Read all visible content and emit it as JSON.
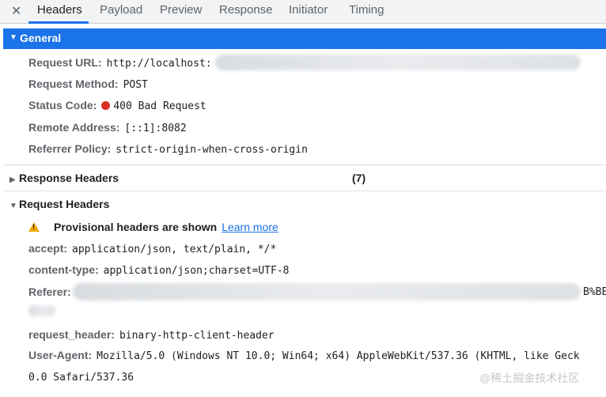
{
  "tabs": {
    "close": "✕",
    "items": [
      "Headers",
      "Payload",
      "Preview",
      "Response",
      "Initiator",
      "Timing"
    ],
    "active": "Headers"
  },
  "general": {
    "title": "General",
    "rows": {
      "request_url": {
        "key": "Request URL:",
        "value": "http://localhost:"
      },
      "request_method": {
        "key": "Request Method:",
        "value": "POST"
      },
      "status_code": {
        "key": "Status Code:",
        "value": "400 Bad Request",
        "status_color": "#d93025"
      },
      "remote_address": {
        "key": "Remote Address:",
        "value": "[::1]:8082"
      },
      "referrer_policy": {
        "key": "Referrer Policy:",
        "value": "strict-origin-when-cross-origin"
      }
    }
  },
  "response_headers": {
    "title": "Response Headers",
    "count": "(7)"
  },
  "request_headers": {
    "title": "Request Headers",
    "warning": "Provisional headers are shown",
    "learn_more": "Learn more",
    "rows": {
      "accept": {
        "key": "accept:",
        "value": "application/json, text/plain, */*"
      },
      "content_type": {
        "key": "content-type:",
        "value": "application/json;charset=UTF-8"
      },
      "referer": {
        "key": "Referer:",
        "value_tail": "B%BE"
      },
      "request_header": {
        "key": "request_header:",
        "value": "binary-http-client-header"
      },
      "user_agent": {
        "key": "User-Agent:",
        "value": "Mozilla/5.0 (Windows NT 10.0; Win64; x64) AppleWebKit/537.36 (KHTML, like Geck",
        "value_line2": "0.0 Safari/537.36"
      }
    }
  },
  "watermark": "@稀土掘金技术社区",
  "colors": {
    "accent": "#1a73e8",
    "warning": "#f2a600"
  }
}
